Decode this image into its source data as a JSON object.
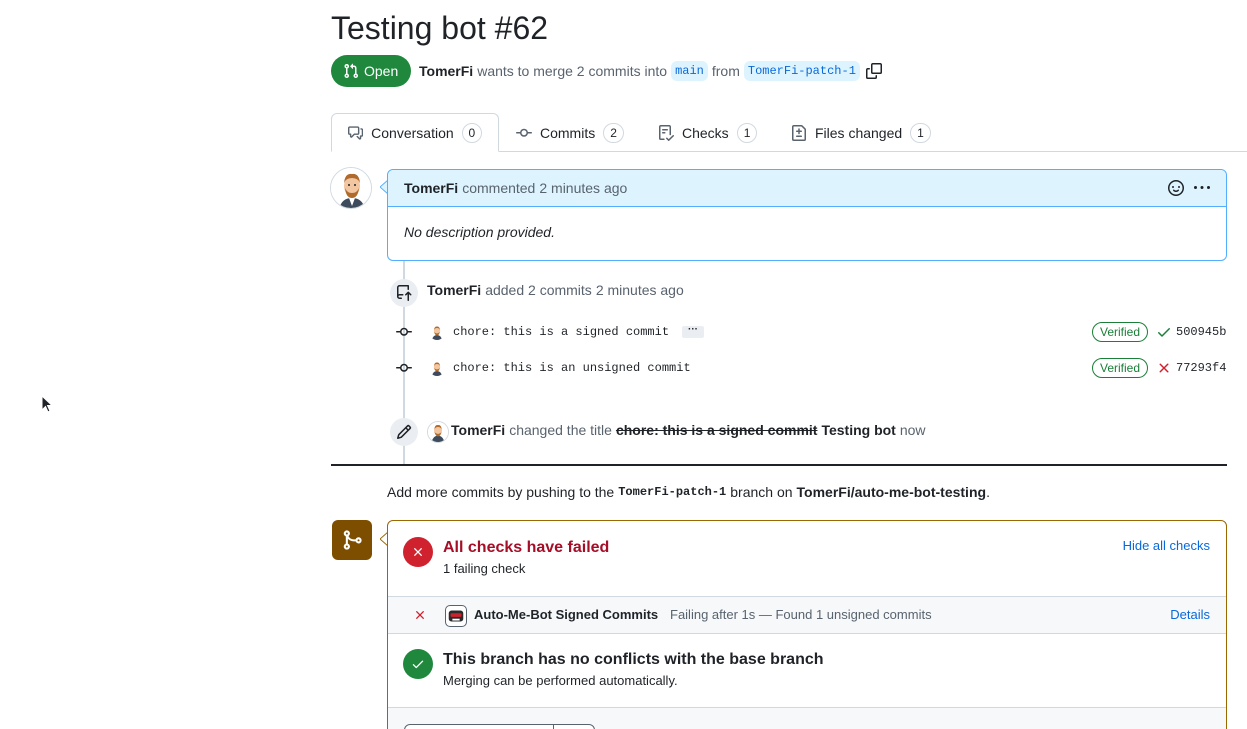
{
  "pr": {
    "title": "Testing bot #62",
    "state": "Open",
    "author": "TomerFi",
    "meta_mid": "wants to merge 2 commits into",
    "base_branch": "main",
    "meta_from": "from",
    "head_branch": "TomerFi-patch-1"
  },
  "tabs": [
    {
      "label": "Conversation",
      "count": "0"
    },
    {
      "label": "Commits",
      "count": "2"
    },
    {
      "label": "Checks",
      "count": "1"
    },
    {
      "label": "Files changed",
      "count": "1"
    }
  ],
  "comment": {
    "author": "TomerFi",
    "action": "commented",
    "time": "2 minutes ago",
    "body": "No description provided."
  },
  "timeline": {
    "push": {
      "author": "TomerFi",
      "text": "added 2 commits",
      "time": "2 minutes ago"
    },
    "commits": [
      {
        "message": "chore: this is a signed commit",
        "ellipsis": "···",
        "badge": "Verified",
        "status": "success",
        "sha": "500945b"
      },
      {
        "message": "chore: this is an unsigned commit",
        "badge": "Verified",
        "status": "failure",
        "sha": "77293f4"
      }
    ],
    "rename": {
      "author": "TomerFi",
      "text": "changed the title",
      "old_title": "chore: this is a signed commit",
      "new_title": "Testing bot",
      "time": "now"
    }
  },
  "push_note": {
    "before": "Add more commits by pushing to the",
    "branch": "TomerFi-patch-1",
    "middle": "branch on",
    "repo": "TomerFi/auto-me-bot-testing",
    "after": "."
  },
  "merge_box": {
    "checks_title": "All checks have failed",
    "checks_sub": "1 failing check",
    "hide_link": "Hide all checks",
    "check": {
      "name": "Auto-Me-Bot Signed Commits",
      "desc": "Failing after 1s — Found 1 unsigned commits",
      "details": "Details"
    },
    "conflicts_title": "This branch has no conflicts with the base branch",
    "conflicts_sub": "Merging can be performed automatically."
  },
  "colors": {
    "open_green": "#1f883d",
    "danger": "#cf222e",
    "danger_text": "#a40e26",
    "success": "#1a7f37",
    "accent": "#0969da",
    "merge_brown": "#7d4e00"
  }
}
